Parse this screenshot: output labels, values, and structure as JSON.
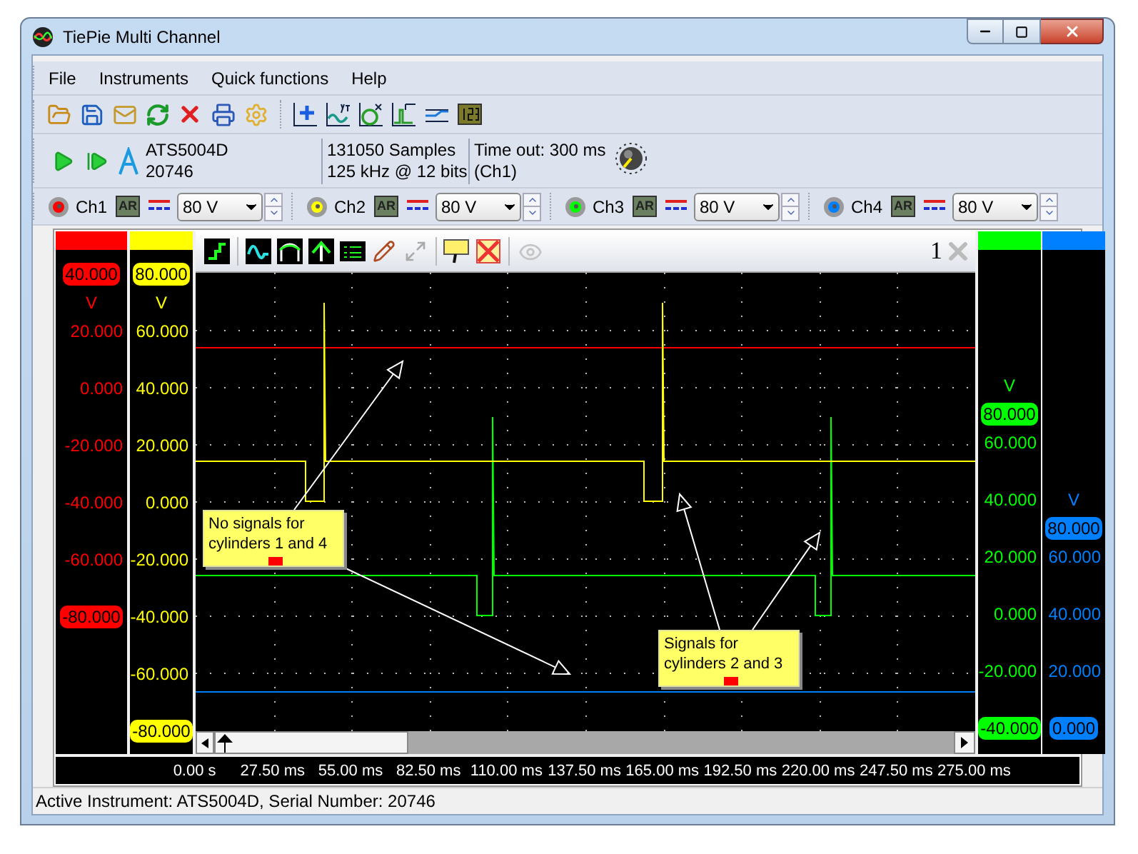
{
  "window": {
    "title": "TiePie Multi Channel"
  },
  "menu": [
    {
      "label": "File"
    },
    {
      "label": "Instruments"
    },
    {
      "label": "Quick functions"
    },
    {
      "label": "Help"
    }
  ],
  "instrument": {
    "name": "ATS5004D",
    "serial": "20746",
    "samples": "131050 Samples",
    "rate": "125 kHz @ 12 bits",
    "timeout": "Time out: 300 ms",
    "source": "(Ch1)"
  },
  "channels": [
    {
      "label": "Ch1",
      "color": "#ff0000",
      "auto_range": "AR",
      "range": "80 V"
    },
    {
      "label": "Ch2",
      "color": "#ffff00",
      "auto_range": "AR",
      "range": "80 V"
    },
    {
      "label": "Ch3",
      "color": "#00ff00",
      "auto_range": "AR",
      "range": "80 V"
    },
    {
      "label": "Ch4",
      "color": "#0080ff",
      "auto_range": "AR",
      "range": "80 V"
    }
  ],
  "scope": {
    "number": "1",
    "left_axes": [
      {
        "color": "#ff0000",
        "labels": [
          {
            "kind": "badge",
            "text": "40.000"
          },
          {
            "kind": "unit",
            "text": "V"
          },
          {
            "kind": "tick",
            "text": "20.000"
          },
          {
            "kind": "tick",
            "text": "0.000"
          },
          {
            "kind": "tick",
            "text": "-20.000"
          },
          {
            "kind": "tick",
            "text": "-40.000"
          },
          {
            "kind": "tick",
            "text": "-60.000"
          },
          {
            "kind": "badge",
            "text": "-80.000"
          }
        ]
      },
      {
        "color": "#ffff00",
        "labels": [
          {
            "kind": "badge",
            "text": "80.000"
          },
          {
            "kind": "unit",
            "text": "V"
          },
          {
            "kind": "tick",
            "text": "60.000"
          },
          {
            "kind": "tick",
            "text": "40.000"
          },
          {
            "kind": "tick",
            "text": "20.000"
          },
          {
            "kind": "tick",
            "text": "0.000"
          },
          {
            "kind": "tick",
            "text": "-20.000"
          },
          {
            "kind": "tick",
            "text": "-40.000"
          },
          {
            "kind": "tick",
            "text": "-60.000"
          },
          {
            "kind": "badge",
            "text": "-80.000"
          }
        ]
      }
    ],
    "right_axes": [
      {
        "color": "#00ff00",
        "labels": [
          {
            "kind": "unit",
            "text": "V"
          },
          {
            "kind": "badge",
            "text": "80.000"
          },
          {
            "kind": "tick",
            "text": "60.000"
          },
          {
            "kind": "tick",
            "text": "40.000"
          },
          {
            "kind": "tick",
            "text": "20.000"
          },
          {
            "kind": "tick",
            "text": "0.000"
          },
          {
            "kind": "tick",
            "text": "-20.000"
          },
          {
            "kind": "badge",
            "text": "-40.000"
          }
        ]
      },
      {
        "color": "#0080ff",
        "labels": [
          {
            "kind": "unit",
            "text": "V"
          },
          {
            "kind": "badge",
            "text": "80.000"
          },
          {
            "kind": "tick",
            "text": "60.000"
          },
          {
            "kind": "tick",
            "text": "40.000"
          },
          {
            "kind": "tick",
            "text": "20.000"
          },
          {
            "kind": "badge",
            "text": "0.000"
          }
        ]
      }
    ],
    "annotations": [
      {
        "text": "No signals for\ncylinders 1 and 4"
      },
      {
        "text": "Signals for\ncylinders 2 and 3"
      }
    ],
    "time_labels": [
      "0.00 s",
      "27.50 ms",
      "55.00 ms",
      "82.50 ms",
      "110.00 ms",
      "137.50 ms",
      "165.00 ms",
      "192.50 ms",
      "220.00 ms",
      "247.50 ms",
      "275.00 ms"
    ]
  },
  "status_bar": "Active Instrument: ATS5004D, Serial Number: 20746"
}
